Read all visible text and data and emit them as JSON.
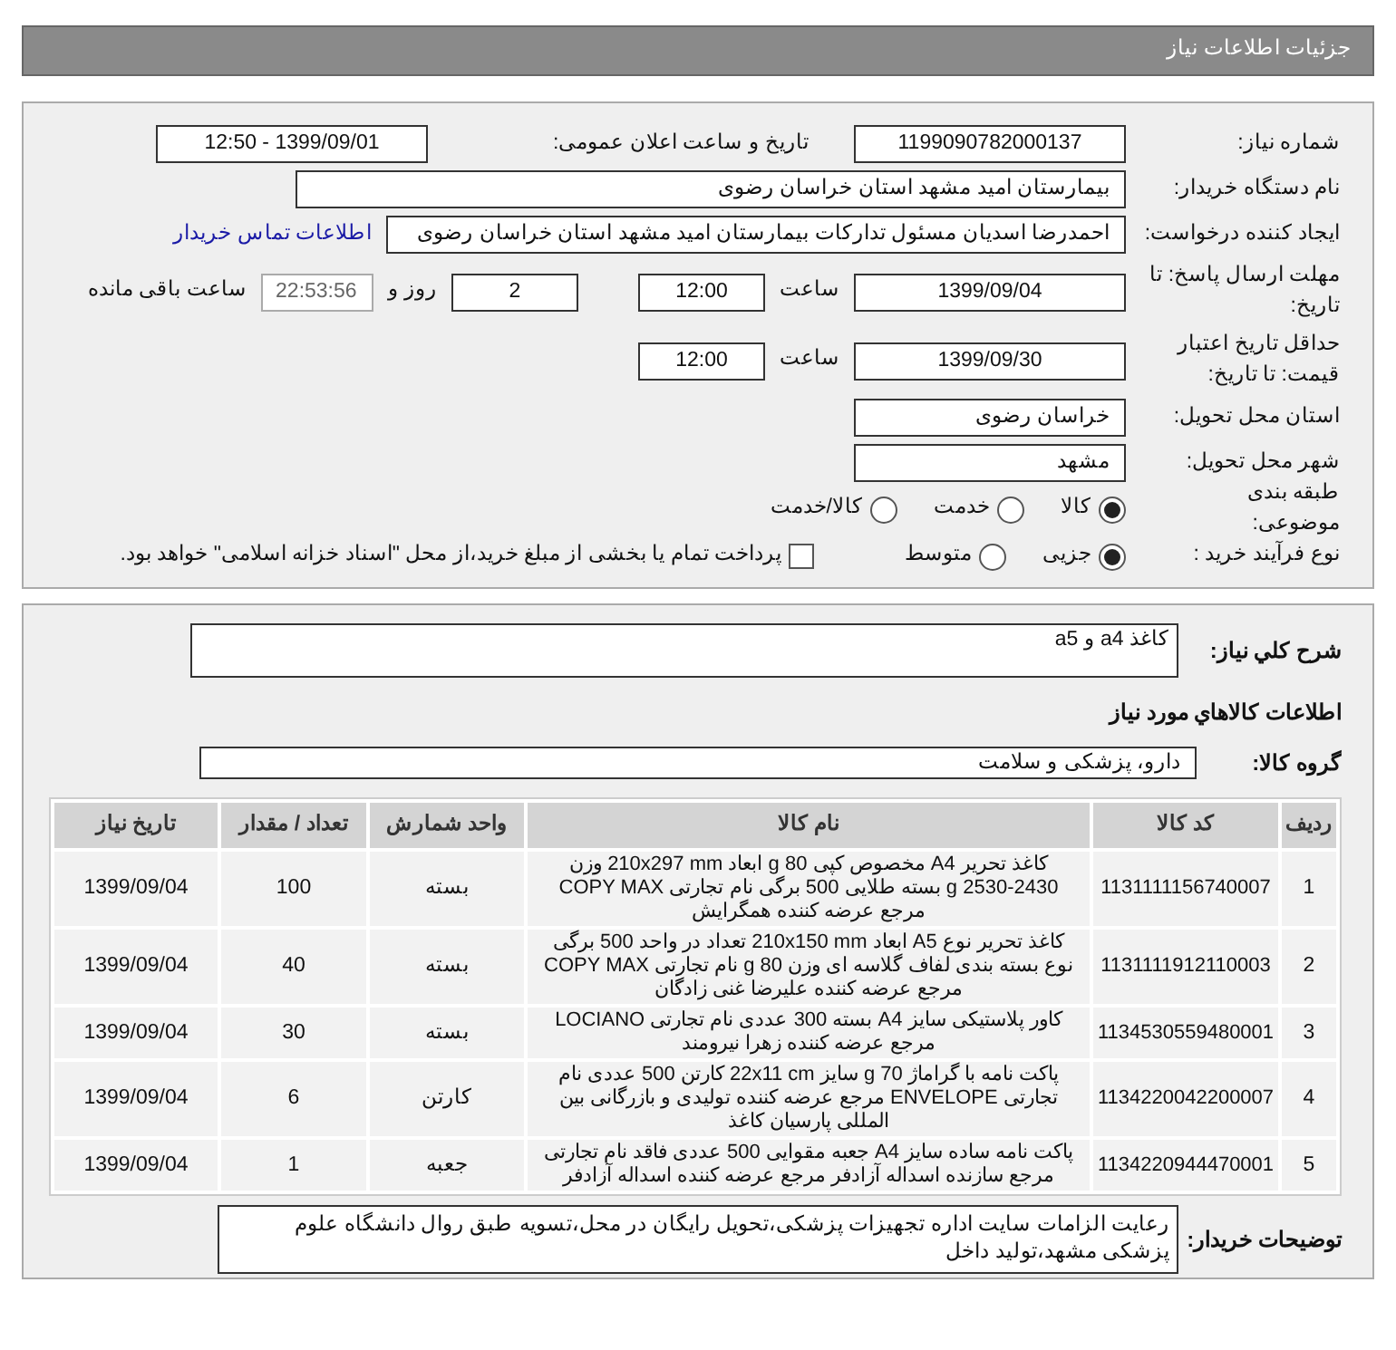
{
  "header": {
    "title": "جزئیات اطلاعات نیاز"
  },
  "details": {
    "need_number": {
      "label": "شماره نیاز:",
      "value": "1199090782000137"
    },
    "announce": {
      "label": "تاریخ و ساعت اعلان عمومی:",
      "value": "1399/09/01 - 12:50"
    },
    "buyer": {
      "label": "نام دستگاه خریدار:",
      "value": "بیمارستان امید مشهد استان خراسان رضوی"
    },
    "creator": {
      "label": "ایجاد کننده درخواست:",
      "value": "احمدرضا اسدیان مسئول تدارکات بیمارستان امید مشهد استان خراسان رضوی",
      "link": "اطلاعات تماس خریدار"
    },
    "deadline": {
      "label": "مهلت ارسال پاسخ: تا تاریخ:",
      "date": "1399/09/04",
      "time_label": "ساعت",
      "time": "12:00",
      "days": "2",
      "days_label": "روز و",
      "remaining": "22:53:56",
      "remaining_label": "ساعت باقی مانده"
    },
    "validity": {
      "label": "حداقل تاریخ اعتبار قیمت: تا تاریخ:",
      "date": "1399/09/30",
      "time_label": "ساعت",
      "time": "12:00"
    },
    "province": {
      "label": "استان محل تحویل:",
      "value": "خراسان رضوی"
    },
    "city": {
      "label": "شهر محل تحویل:",
      "value": "مشهد"
    },
    "category": {
      "label": "طبقه بندی موضوعی:",
      "options": [
        {
          "label": "کالا",
          "selected": true
        },
        {
          "label": "خدمت",
          "selected": false
        },
        {
          "label": "کالا/خدمت",
          "selected": false
        }
      ]
    },
    "process": {
      "label": "نوع فرآیند خرید :",
      "options": [
        {
          "label": "جزیی",
          "selected": true
        },
        {
          "label": "متوسط",
          "selected": false
        }
      ],
      "treasury": {
        "label": "پرداخت تمام یا بخشی از مبلغ خرید،از محل \"اسناد خزانه اسلامی\" خواهد بود.",
        "checked": false
      }
    }
  },
  "summary": {
    "label": "شرح كلي نياز:",
    "value": "کاغذ a4 و a5"
  },
  "goods_title": "اطلاعات كالاهاي مورد نياز",
  "group": {
    "label": "گروه کالا:",
    "value": "دارو، پزشکی و سلامت"
  },
  "table": {
    "columns": [
      "ردیف",
      "کد کالا",
      "نام کالا",
      "واحد شمارش",
      "تعداد / مقدار",
      "تاریخ نیاز"
    ],
    "rows": [
      [
        "1",
        "1131111156740007",
        "کاغذ تحریر A4 مخصوص کپی 80 g ابعاد 210x297 mm وزن 2430-2530 g بسته طلایی 500 برگی نام تجارتی COPY MAX مرجع عرضه کننده همگرایش",
        "بسته",
        "100",
        "1399/09/04"
      ],
      [
        "2",
        "1131111912110003",
        "کاغذ تحریر نوع A5 ابعاد 210x150 mm تعداد در واحد 500 برگی نوع بسته بندی لفاف گلاسه ای وزن 80 g نام تجارتی COPY MAX مرجع عرضه کننده علیرضا غنی زادگان",
        "بسته",
        "40",
        "1399/09/04"
      ],
      [
        "3",
        "1134530559480001",
        "کاور پلاستیکی سایز A4 بسته 300 عددی نام تجارتی LOCIANO مرجع عرضه کننده زهرا نیرومند",
        "بسته",
        "30",
        "1399/09/04"
      ],
      [
        "4",
        "1134220042200007",
        "پاکت نامه با گراماژ 70 g سایز 22x11 cm کارتن 500 عددی نام تجارتی ENVELOPE مرجع عرضه کننده تولیدی و بازرگانی بین المللی پارسیان کاغذ",
        "کارتن",
        "6",
        "1399/09/04"
      ],
      [
        "5",
        "1134220944470001",
        "پاکت نامه ساده سایز A4 جعبه مقوایی 500 عددی فاقد نام تجارتی مرجع سازنده اسداله آزادفر مرجع عرضه کننده اسداله آزادفر",
        "جعبه",
        "1",
        "1399/09/04"
      ]
    ]
  },
  "notes": {
    "label": "توضیحات خریدار:",
    "value": "رعایت الزامات سایت اداره تجهیزات پزشکی،تحویل رایگان در محل،تسویه طبق روال دانشگاه علوم پزشکی مشهد،تولید داخل"
  }
}
